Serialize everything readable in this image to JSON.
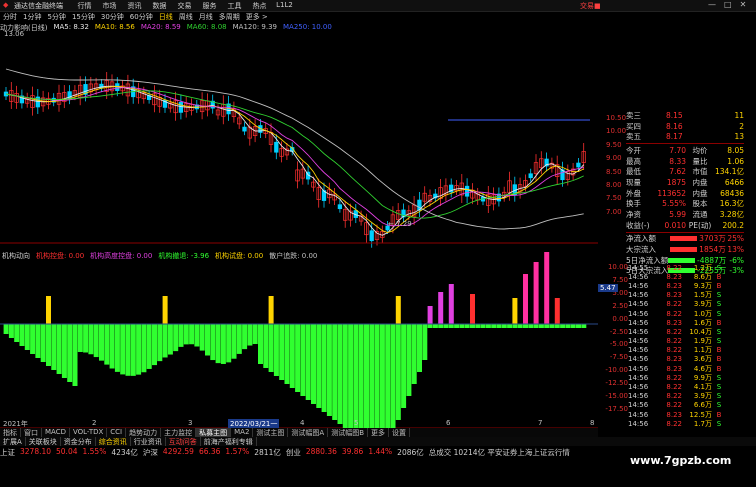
{
  "window": {
    "app_title": "通达信金融终端",
    "menu": [
      "行情",
      "市场",
      "资讯",
      "数据",
      "交易",
      "服务",
      "工具",
      "热点",
      "L1L2"
    ],
    "brand": "交易■",
    "controls": [
      "—",
      "□",
      "✕"
    ]
  },
  "periods": [
    "分时",
    "1分钟",
    "5分钟",
    "15分钟",
    "30分钟",
    "60分钟",
    "日线",
    "周线",
    "月线",
    "多周期",
    "更多 >"
  ],
  "active_period": "日线",
  "ma_line": {
    "name": "动力影响(日线)",
    "items": [
      {
        "label": "MA5: 8.32",
        "color": "#e8e8e8"
      },
      {
        "label": "MA10: 8.56",
        "color": "#ffd400"
      },
      {
        "label": "MA20: 8.59",
        "color": "#e040e0"
      },
      {
        "label": "MA60: 8.08",
        "color": "#30d030"
      },
      {
        "label": "MA120: 9.39",
        "color": "#c0c0c0"
      },
      {
        "label": "MA250: 10.00",
        "color": "#4060ff"
      }
    ]
  },
  "price_axis": [
    "10.50",
    "10.00",
    "9.50",
    "9.00",
    "8.50",
    "8.00",
    "7.50",
    "7.00"
  ],
  "chart_labels": {
    "high": "13.06",
    "low": "7.29",
    "low_prefix": "← "
  },
  "lower_title": {
    "name": "机构动向",
    "items": [
      {
        "label": "机构控盘: 0.00",
        "color": "#ff3030"
      },
      {
        "label": "机构高度控盘: 0.00",
        "color": "#e040e0"
      },
      {
        "label": "机构撤退: -3.96",
        "color": "#30ff30"
      },
      {
        "label": "机构试盘: 0.00",
        "color": "#ffd400"
      },
      {
        "label": "散户追跌: 0.00",
        "color": "#c0c0c0"
      }
    ]
  },
  "lower_axis": [
    "10.00",
    "7.50",
    "5.00",
    "2.50",
    "0.00",
    "-2.50",
    "-5.00",
    "-7.50",
    "-10.00",
    "-12.50",
    "-15.00",
    "-17.50"
  ],
  "lower_marker": "5.47",
  "date_bar": {
    "left": "2021年",
    "mid": "2022/03/21一",
    "numbers": [
      "2",
      "3",
      "4",
      "5",
      "6",
      "7",
      "8"
    ]
  },
  "quote_panel": {
    "asks": [
      {
        "name": "卖三",
        "price": "8.15",
        "vol": "11"
      },
      {
        "name": "买四",
        "price": "8.16",
        "vol": "2"
      },
      {
        "name": "卖五",
        "price": "8.17",
        "vol": "13"
      }
    ],
    "stats": [
      {
        "a": "今开",
        "b": "7.70",
        "c": "均价",
        "d": "8.05"
      },
      {
        "a": "最高",
        "b": "8.33",
        "c": "量比",
        "d": "1.06"
      },
      {
        "a": "最低",
        "b": "7.62",
        "c": "市值",
        "d": "134.1亿"
      },
      {
        "a": "现量",
        "b": "1875",
        "c": "内盘",
        "d": "6466"
      },
      {
        "a": "外盘",
        "b": "113652",
        "c": "内盘",
        "d": "68436"
      },
      {
        "a": "换手",
        "b": "5.55%",
        "c": "股本",
        "d": "16.3亿"
      },
      {
        "a": "净资",
        "b": "5.99",
        "c": "流通",
        "d": "3.28亿"
      },
      {
        "a": "收益(-)",
        "b": "0.010",
        "c": "PE(动)",
        "d": "200.2"
      }
    ],
    "flows": [
      {
        "name": "净流入额",
        "val": "3703万",
        "pct": "25%",
        "color": "#ff3030"
      },
      {
        "name": "大宗流入",
        "val": "1854万",
        "pct": "13%",
        "color": "#ff3030"
      },
      {
        "name": "5日净流入额",
        "val": "-4887万",
        "pct": "-6%",
        "color": "#30ff30"
      },
      {
        "name": "5日大宗流入",
        "val": "-2255万",
        "pct": "-3%",
        "color": "#30ff30"
      }
    ],
    "ticks": [
      {
        "t": "14:55",
        "p": "8.22",
        "v": "1.2万",
        "d": "S"
      },
      {
        "t": "14:56",
        "p": "8.23",
        "v": "8.6万",
        "d": "B"
      },
      {
        "t": "14:56",
        "p": "8.23",
        "v": "9.3万",
        "d": "B"
      },
      {
        "t": "14:56",
        "p": "8.23",
        "v": "1.5万",
        "d": "S"
      },
      {
        "t": "14:56",
        "p": "8.22",
        "v": "3.9万",
        "d": "S"
      },
      {
        "t": "14:56",
        "p": "8.22",
        "v": "1.0万",
        "d": "S"
      },
      {
        "t": "14:56",
        "p": "8.23",
        "v": "1.6万",
        "d": "B"
      },
      {
        "t": "14:56",
        "p": "8.22",
        "v": "10.4万",
        "d": "S"
      },
      {
        "t": "14:56",
        "p": "8.22",
        "v": "1.9万",
        "d": "S"
      },
      {
        "t": "14:56",
        "p": "8.22",
        "v": "1.1万",
        "d": "B"
      },
      {
        "t": "14:56",
        "p": "8.23",
        "v": "3.6万",
        "d": "B"
      },
      {
        "t": "14:56",
        "p": "8.23",
        "v": "4.6万",
        "d": "B"
      },
      {
        "t": "14:56",
        "p": "8.22",
        "v": "9.9万",
        "d": "S"
      },
      {
        "t": "14:56",
        "p": "8.22",
        "v": "4.1万",
        "d": "S"
      },
      {
        "t": "14:56",
        "p": "8.22",
        "v": "3.9万",
        "d": "S"
      },
      {
        "t": "14:56",
        "p": "8.22",
        "v": "6.6万",
        "d": "S"
      },
      {
        "t": "14:56",
        "p": "8.23",
        "v": "12.5万",
        "d": "B"
      },
      {
        "t": "14:56",
        "p": "8.22",
        "v": "1.7万",
        "d": "S"
      }
    ]
  },
  "tabs": [
    "指标",
    "窗口",
    "MACD",
    "VOL-TDX",
    "CCI",
    "趋势动力",
    "主力监控",
    "私募主图",
    "MA2",
    "测试主图",
    "测试幅图A",
    "测试幅图B",
    "更多",
    "设置"
  ],
  "active_tab": "私募主图",
  "bottom_links": [
    "扩展A",
    "关联板块",
    "资金分布",
    "综合资讯",
    "行业资讯",
    "互动问答",
    "前海产福利专辑"
  ],
  "status": [
    {
      "label": "上证",
      "v1": "3278.10",
      "v2": "50.04",
      "v3": "1.55%",
      "v4": "4234亿"
    },
    {
      "label": "沪深",
      "v1": "4292.59",
      "v2": "66.36",
      "v3": "1.57%",
      "v4": "2811亿"
    },
    {
      "label": "创业",
      "v1": "2880.36",
      "v2": "39.86",
      "v3": "1.44%",
      "v4": "2086亿"
    }
  ],
  "status_tail": "总成交 10214亿 平安证券上海上证云行情",
  "watermark": "www.7gpzb.com"
}
